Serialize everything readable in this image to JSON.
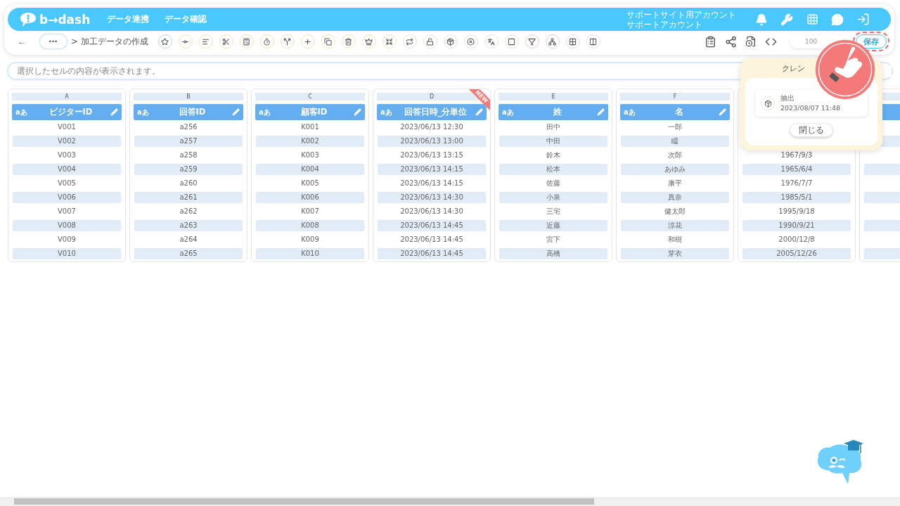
{
  "header": {
    "logo": "b→dash",
    "nav": [
      "データ連携",
      "データ確認"
    ],
    "account": [
      "サポートサイト用アカウント",
      "サポートアカウント"
    ]
  },
  "toolbar": {
    "back": "←",
    "more": "•••",
    "breadcrumb": "> 加工データの作成",
    "zoom": "100",
    "save": "保存",
    "tools": [
      {
        "color": "#b9d3ee"
      },
      {
        "color": "#f3e2b3"
      },
      {
        "color": "#f3e2b3"
      },
      {
        "color": "#f3e2b3"
      },
      {
        "color": "#f3e2b3"
      },
      {
        "color": "#f3e2b3"
      },
      {
        "color": "#f3e2b3"
      },
      {
        "color": "#f3e2b3"
      },
      {
        "color": "#f3e2b3"
      },
      {
        "color": "#f3e2b3"
      },
      {
        "color": "#f3e2b3"
      },
      {
        "color": "#f3e2b3"
      },
      {
        "color": "#dfe8cf"
      },
      {
        "color": "#dfe8cf"
      },
      {
        "color": "#dfe8cf"
      },
      {
        "color": "#dfe8cf"
      },
      {
        "color": "#dfe8cf"
      },
      {
        "color": "#dfe8cf"
      },
      {
        "color": "#f6c8c8"
      },
      {
        "color": "#f6c8c8"
      },
      {
        "color": "#ecd6f3"
      },
      {
        "color": "#ecd6f3"
      }
    ]
  },
  "cell_field": {
    "placeholder": "選択したセルの内容が表示されます。"
  },
  "columns": [
    {
      "letter": "A",
      "type_label": "aあ",
      "name": "ビジターID",
      "values": [
        "V001",
        "V002",
        "V003",
        "V004",
        "V005",
        "V006",
        "V007",
        "V008",
        "V009",
        "V010"
      ]
    },
    {
      "letter": "B",
      "type_label": "aあ",
      "name": "回答ID",
      "values": [
        "a256",
        "a257",
        "a258",
        "a259",
        "a260",
        "a261",
        "a262",
        "a263",
        "a264",
        "a265"
      ]
    },
    {
      "letter": "C",
      "type_label": "aあ",
      "name": "顧客ID",
      "values": [
        "K001",
        "K002",
        "K003",
        "K004",
        "K005",
        "K006",
        "K007",
        "K008",
        "K009",
        "K010"
      ]
    },
    {
      "letter": "D",
      "type_label": "aあ",
      "name": "回答日時_分単位",
      "badge": "NEW",
      "values": [
        "2023/06/13 12:30",
        "2023/06/13 13:00",
        "2023/06/13 13:15",
        "2023/06/13 14:15",
        "2023/06/13 14:15",
        "2023/06/13 14:30",
        "2023/06/13 14:30",
        "2023/06/13 14:45",
        "2023/06/13 14:45",
        "2023/06/13 14:45"
      ]
    },
    {
      "letter": "E",
      "type_label": "aあ",
      "name": "姓",
      "values": [
        "田中",
        "中田",
        "鈴木",
        "松本",
        "佐藤",
        "小泉",
        "三宅",
        "近藤",
        "宮下",
        "高橋"
      ]
    },
    {
      "letter": "F",
      "type_label": "aあ",
      "name": "名",
      "values": [
        "一郎",
        "瞳",
        "次郎",
        "あゆみ",
        "康平",
        "真奈",
        "健太郎",
        "涼花",
        "和樹",
        "芽衣"
      ]
    },
    {
      "values": [
        "1967/9/3",
        "1965/6/4",
        "1976/7/7",
        "1985/5/1",
        "1995/9/18",
        "1990/9/21",
        "2000/12/8",
        "2005/12/26"
      ]
    }
  ],
  "history_popup": {
    "title": "クレン",
    "items": [
      {
        "label": "抽出",
        "time": "2023/08/07 11:48"
      }
    ],
    "close": "閉じる"
  }
}
